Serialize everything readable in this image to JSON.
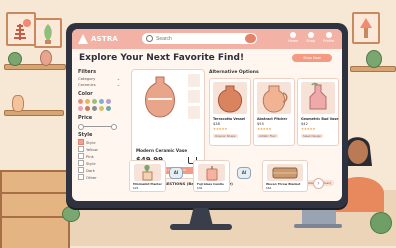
{
  "header": {
    "logo_text": "ASTRA",
    "search_placeholder": "Search",
    "nav": [
      {
        "label": "Home",
        "icon": "home-icon"
      },
      {
        "label": "Shop",
        "icon": "bag-icon"
      },
      {
        "label": "Profile",
        "icon": "user-icon"
      }
    ]
  },
  "page": {
    "title": "Explore Your Next Favorite Find!",
    "shop_button": "Shop Now"
  },
  "filters": {
    "heading": "Filters",
    "rows": [
      {
        "label": "Category"
      },
      {
        "label": "Ceramics"
      }
    ],
    "color_heading": "Color",
    "colors": [
      "#e88f7a",
      "#f2b15a",
      "#9bc27a",
      "#7fb0d6",
      "#b79ad6",
      "#e8a3b7",
      "#c97d5a",
      "#8c8c8c",
      "#d9c070",
      "#6fa9a0"
    ],
    "price_heading": "Price",
    "style_heading": "Style",
    "style_options": [
      {
        "label": "Style",
        "checked": true
      },
      {
        "label": "Yellow",
        "checked": false
      },
      {
        "label": "Pink",
        "checked": false
      },
      {
        "label": "Style",
        "checked": false
      },
      {
        "label": "Dark",
        "checked": false
      },
      {
        "label": "Other",
        "checked": false
      }
    ]
  },
  "featured": {
    "name": "Modern Ceramic Vase",
    "price": "$49.99",
    "cta": "VIEW DETAILS & ADD THIS"
  },
  "alternatives": {
    "heading": "Alternative Options",
    "items": [
      {
        "name": "Terracotta Vessel",
        "price": "$38",
        "stars": "★★★★★",
        "tag": "Organic Shape"
      },
      {
        "name": "Abstract Pitcher",
        "price": "$55",
        "stars": "★★★★★",
        "tag": "Artistic Flair"
      },
      {
        "name": "Geometric Bud Vase",
        "price": "$42",
        "stars": "★★★★★",
        "tag": "Sleek Design"
      }
    ]
  },
  "ai": {
    "heading": "SMART AI SUGGESTIONS (Based on Your Style)",
    "tag": "Personalized for [User]",
    "bot_label": "AI",
    "items": [
      {
        "name": "Minimalist Planter",
        "price": "$29"
      },
      {
        "name": "Fuji Glass Candle",
        "price": "$36"
      },
      {
        "name": "Woven Throw Blanket",
        "price": "$64"
      }
    ]
  }
}
